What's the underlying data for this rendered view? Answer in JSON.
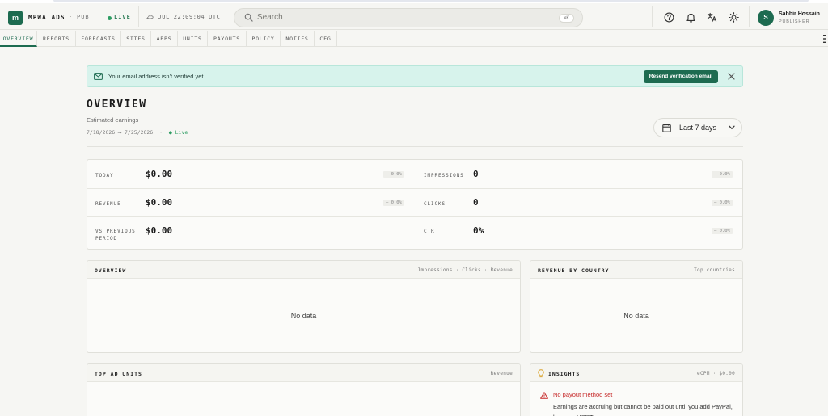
{
  "header": {
    "logo_letter": "m",
    "brand": "MPWA ADS",
    "separator": "·",
    "role_tag": "PUB",
    "live": "LIVE",
    "clock": "25 JUL 22:09:04 UTC",
    "search_placeholder": "Search",
    "search_shortcut": "⌘K",
    "user_initial": "S",
    "user_name": "Sabbir Hossain",
    "user_role": "PUBLISHER"
  },
  "nav": {
    "tabs": [
      "OVERVIEW",
      "REPORTS",
      "FORECASTS",
      "SITES",
      "APPS",
      "UNITS",
      "PAYOUTS",
      "POLICY",
      "NOTIFS",
      "CFG"
    ],
    "active": "OVERVIEW"
  },
  "alert": {
    "message": "Your email address isn't verified yet.",
    "button": "Resend verification email"
  },
  "overview": {
    "title": "OVERVIEW",
    "subtitle": "Estimated earnings",
    "date_from": "7/18/2026",
    "arrow": "⟶",
    "date_to": "7/25/2026",
    "dot_sep": "·",
    "live": "● Live",
    "range_label": "Last 7 days"
  },
  "stats": {
    "today_label": "TODAY",
    "today_value": "$0.00",
    "today_delta": "— 0.0%",
    "revenue_label": "REVENUE",
    "revenue_value": "$0.00",
    "revenue_delta": "— 0.0%",
    "vs_label_1": "VS PREVIOUS",
    "vs_label_2": "PERIOD",
    "vs_value": "$0.00",
    "impressions_label": "IMPRESSIONS",
    "impressions_value": "0",
    "impressions_delta": "— 0.0%",
    "clicks_label": "CLICKS",
    "clicks_value": "0",
    "clicks_delta": "— 0.0%",
    "ctr_label": "CTR",
    "ctr_value": "0%",
    "ctr_delta": "— 0.0%"
  },
  "panels": {
    "overview_title": "OVERVIEW",
    "overview_right": "Impressions · Clicks · Revenue",
    "overview_empty": "No data",
    "country_title": "REVENUE BY COUNTRY",
    "country_right": "Top countries",
    "country_empty": "No data",
    "adunits_title": "TOP AD UNITS",
    "adunits_right": "Revenue",
    "insights_title": "INSIGHTS",
    "insights_right": "eCPM · $0.00",
    "insight_warning": "No payout method set",
    "insight_text": "Earnings are accruing but cannot be paid out until you add PayPal, bank, or USDT."
  },
  "colors": {
    "brand": "#1d6b50",
    "alert_bg": "#d7f3ec",
    "live": "#2e9d63",
    "warning": "#c62828"
  }
}
